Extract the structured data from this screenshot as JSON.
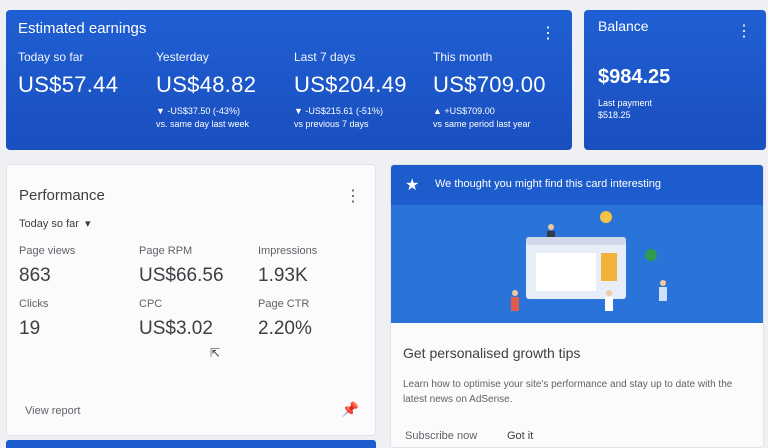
{
  "earnings": {
    "title": "Estimated earnings",
    "metrics": [
      {
        "label": "Today so far",
        "value": "US$57.44",
        "delta": "",
        "comparison": ""
      },
      {
        "label": "Yesterday",
        "value": "US$48.82",
        "delta": "▼ -US$37.50 (-43%)",
        "comparison": "vs. same day last week"
      },
      {
        "label": "Last 7 days",
        "value": "US$204.49",
        "delta": "▼ -US$215.61 (-51%)",
        "comparison": "vs previous 7 days"
      },
      {
        "label": "This month",
        "value": "US$709.00",
        "delta": "▲ +US$709.00",
        "comparison": "vs same period last year"
      }
    ]
  },
  "balance": {
    "title": "Balance",
    "value": "$984.25",
    "last_payment_label": "Last payment",
    "last_payment_value": "$518.25"
  },
  "performance": {
    "title": "Performance",
    "range": "Today so far",
    "metrics": [
      {
        "label": "Page views",
        "value": "863"
      },
      {
        "label": "Page RPM",
        "value": "US$66.56"
      },
      {
        "label": "Impressions",
        "value": "1.93K"
      },
      {
        "label": "Clicks",
        "value": "19"
      },
      {
        "label": "CPC",
        "value": "US$3.02"
      },
      {
        "label": "Page CTR",
        "value": "2.20%"
      }
    ],
    "view_report": "View report"
  },
  "tip": {
    "header": "We thought you might find this card interesting",
    "title": "Get personalised growth tips",
    "body": "Learn how to optimise your site's performance and stay up to date with the latest news on AdSense.",
    "subscribe": "Subscribe now",
    "got_it": "Got it"
  },
  "icons": {
    "menu": "more-vert-icon",
    "star": "star-icon",
    "pin": "pin-icon",
    "dropdown": "triangle-down-icon"
  },
  "colors": {
    "primary": "#1a4fbf",
    "card_bg": "#fbfbfc"
  }
}
